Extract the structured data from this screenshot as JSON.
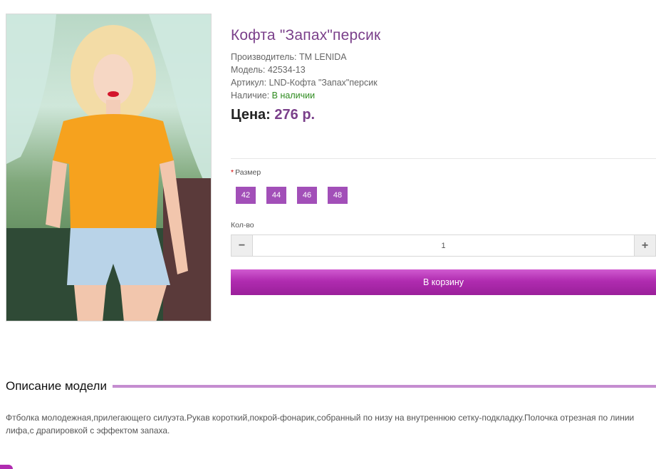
{
  "product": {
    "title": "Кофта \"Запах\"персик",
    "image_alt": "Model wearing orange top and denim shorts",
    "manufacturer_label": "Производитель:",
    "manufacturer_value": "TM LENIDA",
    "model_label": "Модель:",
    "model_value": "42534-13",
    "article_label": "Артикул:",
    "article_value": "LND-Кофта \"Запах\"персик",
    "availability_label": "Наличие:",
    "availability_value": "В наличии",
    "price_label": "Цена:",
    "price_value": "276 р."
  },
  "options": {
    "required_mark": "*",
    "size_label": "Размер",
    "sizes": [
      "42",
      "44",
      "46",
      "48"
    ],
    "qty_label": "Кол-во",
    "qty_minus": "−",
    "qty_plus": "+",
    "qty_value": "1"
  },
  "cart": {
    "label": "В корзину"
  },
  "description": {
    "heading": "Описание модели",
    "text": "Фтболка молодежная,прилегающего силуэта.Рукав короткий,покрой-фонарик,собранный по низу на внутреннюю сетку-подкладку.Полочка отрезная по линии лифа,с драпировкой с эффектом запаха."
  },
  "colors": {
    "accent": "#a24fb8",
    "title": "#7a3f8a",
    "stock": "#2e8b1f",
    "button": "#b02cb0"
  }
}
